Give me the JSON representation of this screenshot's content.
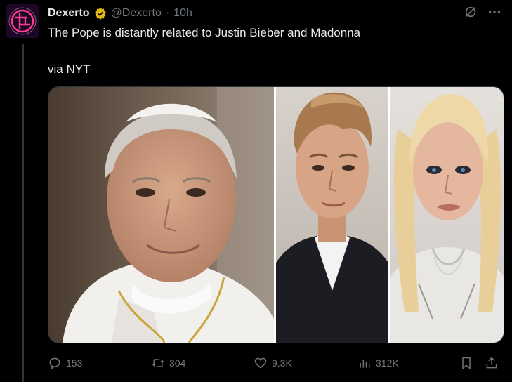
{
  "post": {
    "author_name": "Dexerto",
    "handle": "@Dexerto",
    "separator": "·",
    "time": "10h",
    "text_line1": "The Pope is distantly related to Justin Bieber and Madonna",
    "text_line2": "via NYT",
    "verified_badge_color": "#e2b719"
  },
  "media": {
    "panels": [
      {
        "subject": "pope-portrait"
      },
      {
        "subject": "justin-bieber-portrait"
      },
      {
        "subject": "madonna-portrait"
      }
    ]
  },
  "actions": {
    "replies": "153",
    "reposts": "304",
    "likes": "9.3K",
    "views": "312K",
    "icons": [
      "reply-icon",
      "repost-icon",
      "like-icon",
      "views-icon",
      "bookmark-icon",
      "share-icon"
    ]
  },
  "colors": {
    "background": "#000000",
    "text_primary": "#e7e9ea",
    "text_secondary": "#71767b",
    "avatar_accent": "#ff3c8e"
  }
}
